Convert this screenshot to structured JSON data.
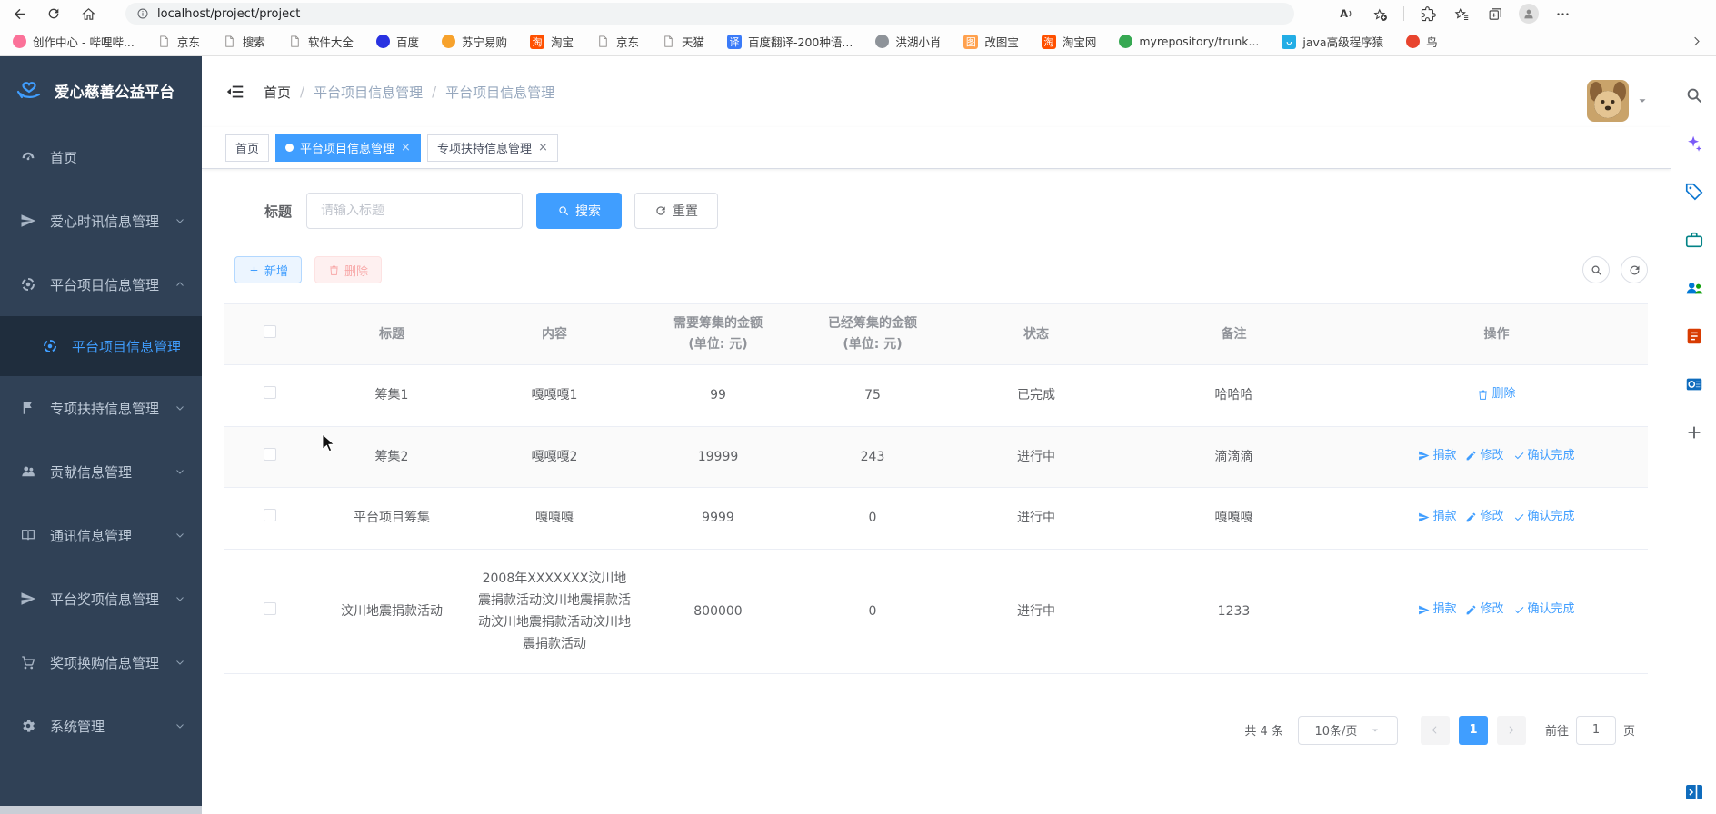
{
  "browser": {
    "url": "localhost/project/project",
    "nav_icons": [
      "back",
      "refresh",
      "home"
    ],
    "action_icons": [
      "read-aloud",
      "add-favorite",
      "extensions",
      "favorites",
      "collections",
      "profile",
      "more"
    ],
    "bookmarks": [
      {
        "label": "创作中心 - 哔哩哔...",
        "icon": "bilibili-icon",
        "kind": "dot",
        "color": "#fb7299"
      },
      {
        "label": "京东",
        "icon": "page-icon",
        "kind": "page"
      },
      {
        "label": "搜索",
        "icon": "page-icon",
        "kind": "page"
      },
      {
        "label": "软件大全",
        "icon": "page-icon",
        "kind": "page"
      },
      {
        "label": "百度",
        "icon": "baidu-icon",
        "kind": "dot",
        "color": "#2932e1"
      },
      {
        "label": "苏宁易购",
        "icon": "suning-icon",
        "kind": "dot",
        "color": "#f7a22c"
      },
      {
        "label": "淘宝",
        "icon": "taobao-icon",
        "kind": "badge",
        "color": "#ff5000",
        "glyph": "淘"
      },
      {
        "label": "京东",
        "icon": "page-icon",
        "kind": "page"
      },
      {
        "label": "天猫",
        "icon": "page-icon",
        "kind": "page"
      },
      {
        "label": "百度翻译-200种语...",
        "icon": "baidu-translate-icon",
        "kind": "badge",
        "color": "#3b7bf8",
        "glyph": "译"
      },
      {
        "label": "洪湖小肖",
        "icon": "honghu-icon",
        "kind": "dot",
        "color": "#8e9399"
      },
      {
        "label": "改图宝",
        "icon": "gaitubao-icon",
        "kind": "badge",
        "color": "#ffa14e",
        "glyph": "图"
      },
      {
        "label": "淘宝网",
        "icon": "taobao-icon",
        "kind": "badge",
        "color": "#ff5000",
        "glyph": "淘"
      },
      {
        "label": "myrepository/trunk...",
        "icon": "repository-icon",
        "kind": "dot",
        "color": "#36a852"
      },
      {
        "label": "java高级程序猿",
        "icon": "bilibili-tv-icon",
        "kind": "badge",
        "color": "#23ade5",
        "glyph": "ᴗ"
      },
      {
        "label": "鸟",
        "icon": "bird-icon",
        "kind": "dot",
        "color": "#e8442e"
      }
    ]
  },
  "edge_sidebar": {
    "icons": [
      {
        "name": "search",
        "color": "#5f6368"
      },
      {
        "name": "copilot",
        "color": "#7a5af8"
      },
      {
        "name": "shopping",
        "color": "#0b76d1"
      },
      {
        "name": "tools",
        "color": "#038387"
      },
      {
        "name": "people",
        "color": ""
      },
      {
        "name": "reader",
        "color": "#d83b01"
      },
      {
        "name": "outlook",
        "color": "#0f6cbd"
      },
      {
        "name": "add",
        "color": "#5f6368"
      }
    ],
    "bottom_icon": {
      "name": "open-sidebar",
      "color": "#0f6cbd"
    }
  },
  "app": {
    "logo": {
      "title": "爱心慈善公益平台",
      "icon": "hand-heart"
    },
    "menu": [
      {
        "label": "首页",
        "icon": "dashboard"
      },
      {
        "label": "爱心时讯信息管理",
        "icon": "send",
        "arrow": "down"
      },
      {
        "label": "平台项目信息管理",
        "icon": "target",
        "arrow": "up",
        "expanded": true,
        "children": [
          {
            "label": "平台项目信息管理",
            "icon": "target",
            "active": true
          }
        ]
      },
      {
        "label": "专项扶持信息管理",
        "icon": "flag",
        "arrow": "down"
      },
      {
        "label": "贡献信息管理",
        "icon": "users",
        "arrow": "down"
      },
      {
        "label": "通讯信息管理",
        "icon": "book",
        "arrow": "down"
      },
      {
        "label": "平台奖项信息管理",
        "icon": "send",
        "arrow": "down"
      },
      {
        "label": "奖项换购信息管理",
        "icon": "cart",
        "arrow": "down"
      },
      {
        "label": "系统管理",
        "icon": "gear",
        "arrow": "down"
      }
    ],
    "breadcrumb": [
      "首页",
      "平台项目信息管理",
      "平台项目信息管理"
    ],
    "tabs": [
      {
        "label": "首页",
        "active": false,
        "closable": false
      },
      {
        "label": "平台项目信息管理",
        "active": true,
        "closable": true
      },
      {
        "label": "专项扶持信息管理",
        "active": false,
        "closable": true
      }
    ],
    "search": {
      "label": "标题",
      "placeholder": "请输入标题",
      "value": "",
      "search_btn": "搜索",
      "reset_btn": "重置"
    },
    "toolbar": {
      "add_btn": "新增",
      "delete_btn": "删除"
    },
    "table": {
      "headers": [
        {
          "t": "标题"
        },
        {
          "t": "内容"
        },
        {
          "t": "需要筹集的金额",
          "sub": "(单位: 元)"
        },
        {
          "t": "已经筹集的金额",
          "sub": "(单位: 元)"
        },
        {
          "t": "状态"
        },
        {
          "t": "备注"
        },
        {
          "t": "操作"
        }
      ],
      "rows": [
        {
          "title": "筹集1",
          "content": "嘎嘎嘎1",
          "need": "99",
          "raised": "75",
          "status": "已完成",
          "remark": "哈哈哈",
          "actions": [
            {
              "label": "删除",
              "icon": "trash",
              "name": "delete-link"
            }
          ]
        },
        {
          "title": "筹集2",
          "content": "嘎嘎嘎2",
          "need": "19999",
          "raised": "243",
          "status": "进行中",
          "remark": "滴滴滴",
          "actions": [
            {
              "label": "捐款",
              "icon": "send",
              "name": "donate-link"
            },
            {
              "label": "修改",
              "icon": "edit",
              "name": "edit-link"
            },
            {
              "label": "确认完成",
              "icon": "check",
              "name": "confirm-complete-link"
            }
          ]
        },
        {
          "title": "平台项目筹集",
          "content": "嘎嘎嘎",
          "need": "9999",
          "raised": "0",
          "status": "进行中",
          "remark": "嘎嘎嘎",
          "actions": [
            {
              "label": "捐款",
              "icon": "send",
              "name": "donate-link"
            },
            {
              "label": "修改",
              "icon": "edit",
              "name": "edit-link"
            },
            {
              "label": "确认完成",
              "icon": "check",
              "name": "confirm-complete-link"
            }
          ]
        },
        {
          "title": "汶川地震捐款活动",
          "content": "2008年XXXXXXX汶川地震捐款活动汶川地震捐款活动汶川地震捐款活动汶川地震捐款活动",
          "need": "800000",
          "raised": "0",
          "status": "进行中",
          "remark": "1233",
          "actions": [
            {
              "label": "捐款",
              "icon": "send",
              "name": "donate-link"
            },
            {
              "label": "修改",
              "icon": "edit",
              "name": "edit-link"
            },
            {
              "label": "确认完成",
              "icon": "check",
              "name": "confirm-complete-link"
            }
          ]
        }
      ]
    },
    "pagination": {
      "total": "共 4 条",
      "page_size": "10条/页",
      "current": "1",
      "goto_label": "前往",
      "goto_value": "1",
      "page_suffix": "页"
    }
  },
  "colors": {
    "accent": "#409eff",
    "sidebar_bg": "#304156",
    "submenu_bg": "#1f2d3d",
    "stripe": "#fafafa",
    "link": "#409eff",
    "danger_light": "#fef0f0"
  }
}
